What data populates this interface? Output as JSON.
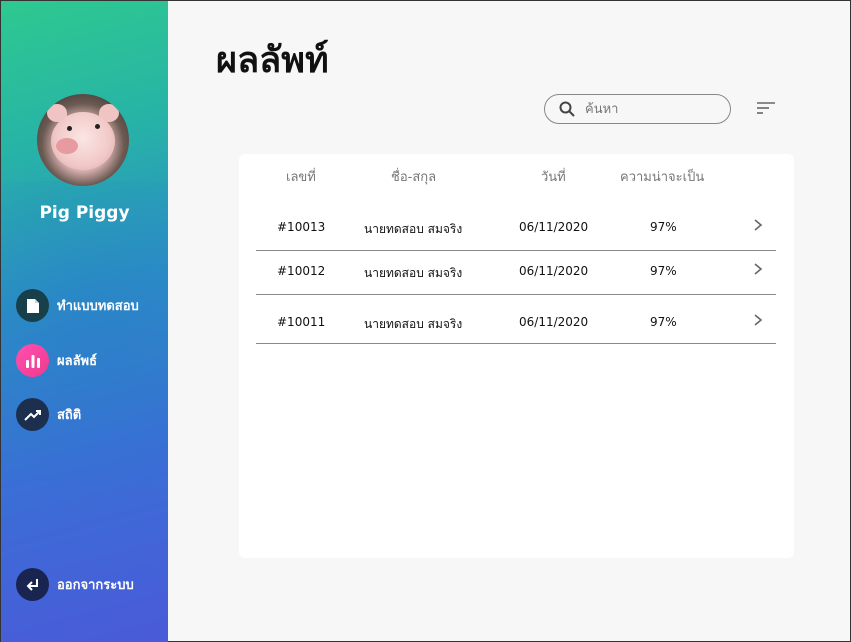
{
  "sidebar": {
    "username": "Pig Piggy",
    "items": [
      {
        "label": "ทำแบบทดสอบ",
        "icon": "document-icon"
      },
      {
        "label": "ผลลัพธ์",
        "icon": "bar-chart-icon"
      },
      {
        "label": "สถิติ",
        "icon": "trending-up-icon"
      }
    ],
    "logout_label": "ออกจากระบบ"
  },
  "main": {
    "title": "ผลลัพท์",
    "search": {
      "placeholder": "ค้นหา"
    },
    "table": {
      "headers": [
        "เลขที่",
        "ชื่อ-สกุล",
        "วันที่",
        "ความน่าจะเป็น"
      ],
      "rows": [
        {
          "id": "#10013",
          "name": "นายทดสอบ สมจริง",
          "date": "06/11/2020",
          "probability": "97%"
        },
        {
          "id": "#10012",
          "name": "นายทดสอบ สมจริง",
          "date": "06/11/2020",
          "probability": "97%"
        },
        {
          "id": "#10011",
          "name": "นายทดสอบ สมจริง",
          "date": "06/11/2020",
          "probability": "97%"
        }
      ]
    }
  },
  "colors": {
    "active_nav": "#f03a8e",
    "nav_icon_bg": "#17404a",
    "sidebar_gradient_start": "#2ec98f",
    "sidebar_gradient_end": "#4a5ad8"
  }
}
